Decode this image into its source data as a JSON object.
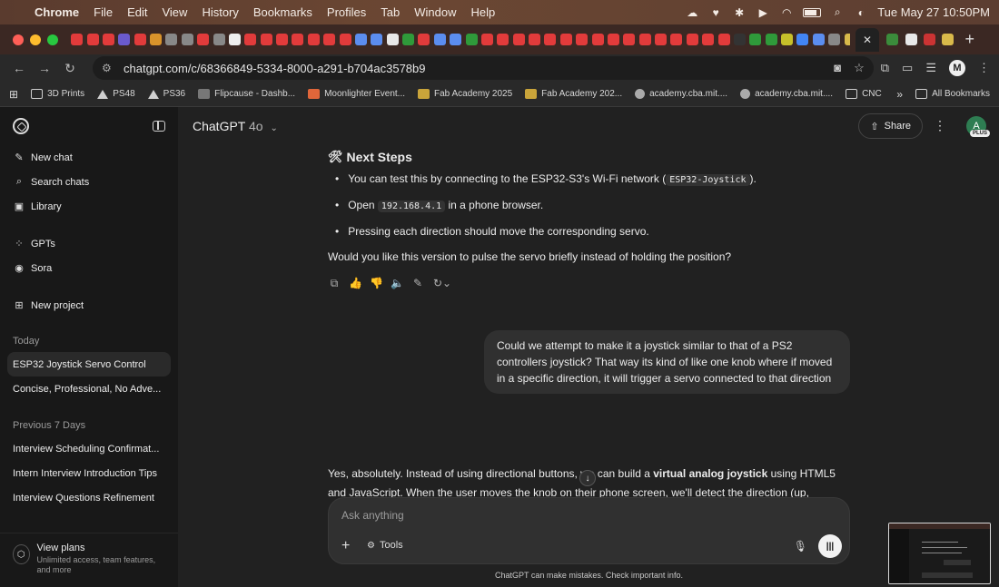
{
  "menubar": {
    "items": [
      "Chrome",
      "File",
      "Edit",
      "View",
      "History",
      "Bookmarks",
      "Profiles",
      "Tab",
      "Window",
      "Help"
    ],
    "datetime": "Tue May 27  10:50PM"
  },
  "address": {
    "url": "chatgpt.com/c/68366849-5334-8000-a291-b704ac3578b9"
  },
  "bookmarks": [
    {
      "label": "3D Prints",
      "icon": "folder-icon"
    },
    {
      "label": "PS48",
      "icon": "triangle-icon"
    },
    {
      "label": "PS36",
      "icon": "triangle-icon"
    },
    {
      "label": "Flipcause - Dashb...",
      "icon": "flipcause-icon"
    },
    {
      "label": "Moonlighter Event...",
      "icon": "moonlighter-icon"
    },
    {
      "label": "Fab Academy 2025",
      "icon": "fab-icon"
    },
    {
      "label": "Fab Academy 202...",
      "icon": "fab-icon"
    },
    {
      "label": "academy.cba.mit....",
      "icon": "globe-icon"
    },
    {
      "label": "academy.cba.mit....",
      "icon": "globe-icon"
    },
    {
      "label": "CNC",
      "icon": "folder-icon"
    }
  ],
  "bookmarks_more": "»",
  "all_bookmarks": "All Bookmarks",
  "sidebar": {
    "nav": [
      {
        "label": "New chat",
        "icon": "✎"
      },
      {
        "label": "Search chats",
        "icon": "⌕"
      },
      {
        "label": "Library",
        "icon": "▣"
      }
    ],
    "nav2": [
      {
        "label": "GPTs",
        "icon": "⁘"
      },
      {
        "label": "Sora",
        "icon": "◉"
      }
    ],
    "project": {
      "label": "New project",
      "icon": "⊞"
    },
    "today_heading": "Today",
    "today": [
      "ESP32 Joystick Servo Control",
      "Concise, Professional, No Adve..."
    ],
    "prev_heading": "Previous 7 Days",
    "previous": [
      "Interview Scheduling Confirmat...",
      "Intern Interview Introduction Tips",
      "Interview Questions Refinement"
    ],
    "view_plans": {
      "title": "View plans",
      "subtitle": "Unlimited access, team features, and more"
    }
  },
  "header": {
    "model": "ChatGPT",
    "version": "4o",
    "share": "Share",
    "avatar": "A",
    "plan_badge": "PLUS"
  },
  "conversation": {
    "heading_icon": "🛠",
    "heading": "Next Steps",
    "bullets": [
      {
        "pre": "You can test this by connecting to the ESP32-S3's Wi-Fi network (",
        "code": "ESP32-Joystick",
        "post": ")."
      },
      {
        "pre": "Open ",
        "code": "192.168.4.1",
        "post": " in a phone browser."
      },
      {
        "pre": "Pressing each direction should move the corresponding servo.",
        "code": "",
        "post": ""
      }
    ],
    "question": "Would you like this version to pulse the servo briefly instead of holding the position?",
    "user_message": "Could we attempt to make it a joystick similar to that of a PS2 controllers joystick? That way its kind of like one knob where if moved in a specific direction, it will trigger a servo connected to that direction",
    "answer_pre": "Yes, absolutely. Instead of using directional buttons, we can build a ",
    "answer_bold": "virtual analog joystick",
    "answer_post": " using HTML5 and JavaScript. When the user moves the knob on their phone screen, we'll detect the direction (up,"
  },
  "composer": {
    "placeholder": "Ask anything",
    "tools": "Tools"
  },
  "disclaimer": "ChatGPT can make mistakes. Check important info."
}
